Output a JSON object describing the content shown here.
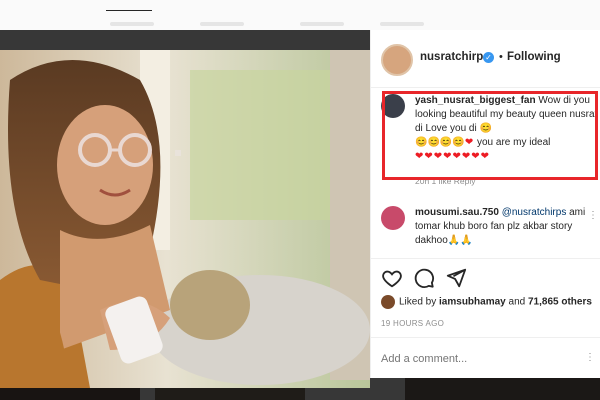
{
  "post": {
    "username": "nusratchirps",
    "follow_status": "Following",
    "separator": "•",
    "likes_prefix": "Liked by",
    "likes_user": "iamsubhamay",
    "likes_and": "and",
    "likes_count": "71,865",
    "likes_suffix": "others",
    "timestamp": "19 HOURS AGO",
    "comment_placeholder": "Add a comment..."
  },
  "comments": [
    {
      "username": "yash_nusrat_biggest_fan",
      "text_1": "Wow di you looking beautiful my beauty queen nusrat di Love you di",
      "text_2": "you are my ideal",
      "emoji_line": "😊😊😊😊",
      "hearts": "❤❤❤❤❤❤❤❤",
      "meta": "20h  1 like  Reply",
      "highlight_color": "#e8262a"
    },
    {
      "username": "mousumi.sau.750",
      "mention": "@nusratchirps",
      "text": "ami tomar khub boro fan plz akbar story dakhoo",
      "emoji": "🙏🙏"
    }
  ],
  "icons": {
    "like": "heart-outline-icon",
    "comment": "speech-bubble-icon",
    "share": "paper-plane-icon",
    "verified": "verified-badge-icon"
  },
  "colors": {
    "verified": "#3897f0",
    "highlight": "#e8262a",
    "mention": "#00376b"
  }
}
